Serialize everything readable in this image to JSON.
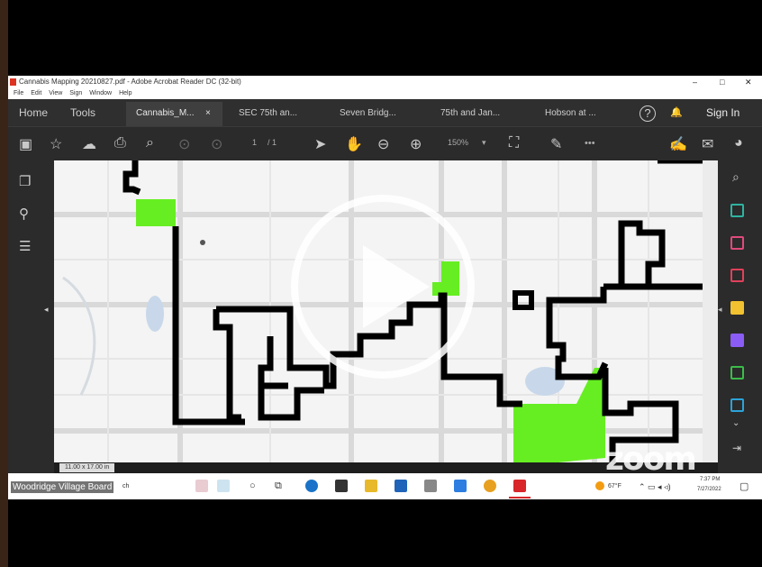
{
  "window": {
    "title": "Cannabis Mapping 20210827.pdf - Adobe Acrobat Reader DC (32-bit)",
    "controls": [
      "–",
      "□",
      "✕"
    ]
  },
  "menu": [
    "File",
    "Edit",
    "View",
    "Sign",
    "Window",
    "Help"
  ],
  "tabs": {
    "home": "Home",
    "tools": "Tools",
    "docs": [
      "Cannabis_M...",
      "SEC 75th an...",
      "Seven Bridg...",
      "75th and Jan...",
      "Hobson at ..."
    ],
    "close": "×",
    "help": "?",
    "bell": "🔔",
    "sign_in": "Sign In"
  },
  "toolbar": {
    "page": "1",
    "page_total": "/ 1",
    "zoom": "150%",
    "more": "•••"
  },
  "statusbar": {
    "page_size": "11.00 x 17.00 in"
  },
  "taskbar": {
    "search_tail": "ch",
    "weather": "67°F",
    "time": "7:37 PM",
    "date": "7/27/2022"
  },
  "overlay": {
    "caption": "Woodridge Village Board",
    "zoom_logo": "zoom"
  },
  "colors": {
    "zone_fill": "#66ee22",
    "boundary": "#000000",
    "map_bg": "#f4f4f4",
    "panel_bg": "#2b2b2b",
    "accent_teal": "#2fb3a0"
  },
  "icons": {
    "play": "play-icon"
  }
}
